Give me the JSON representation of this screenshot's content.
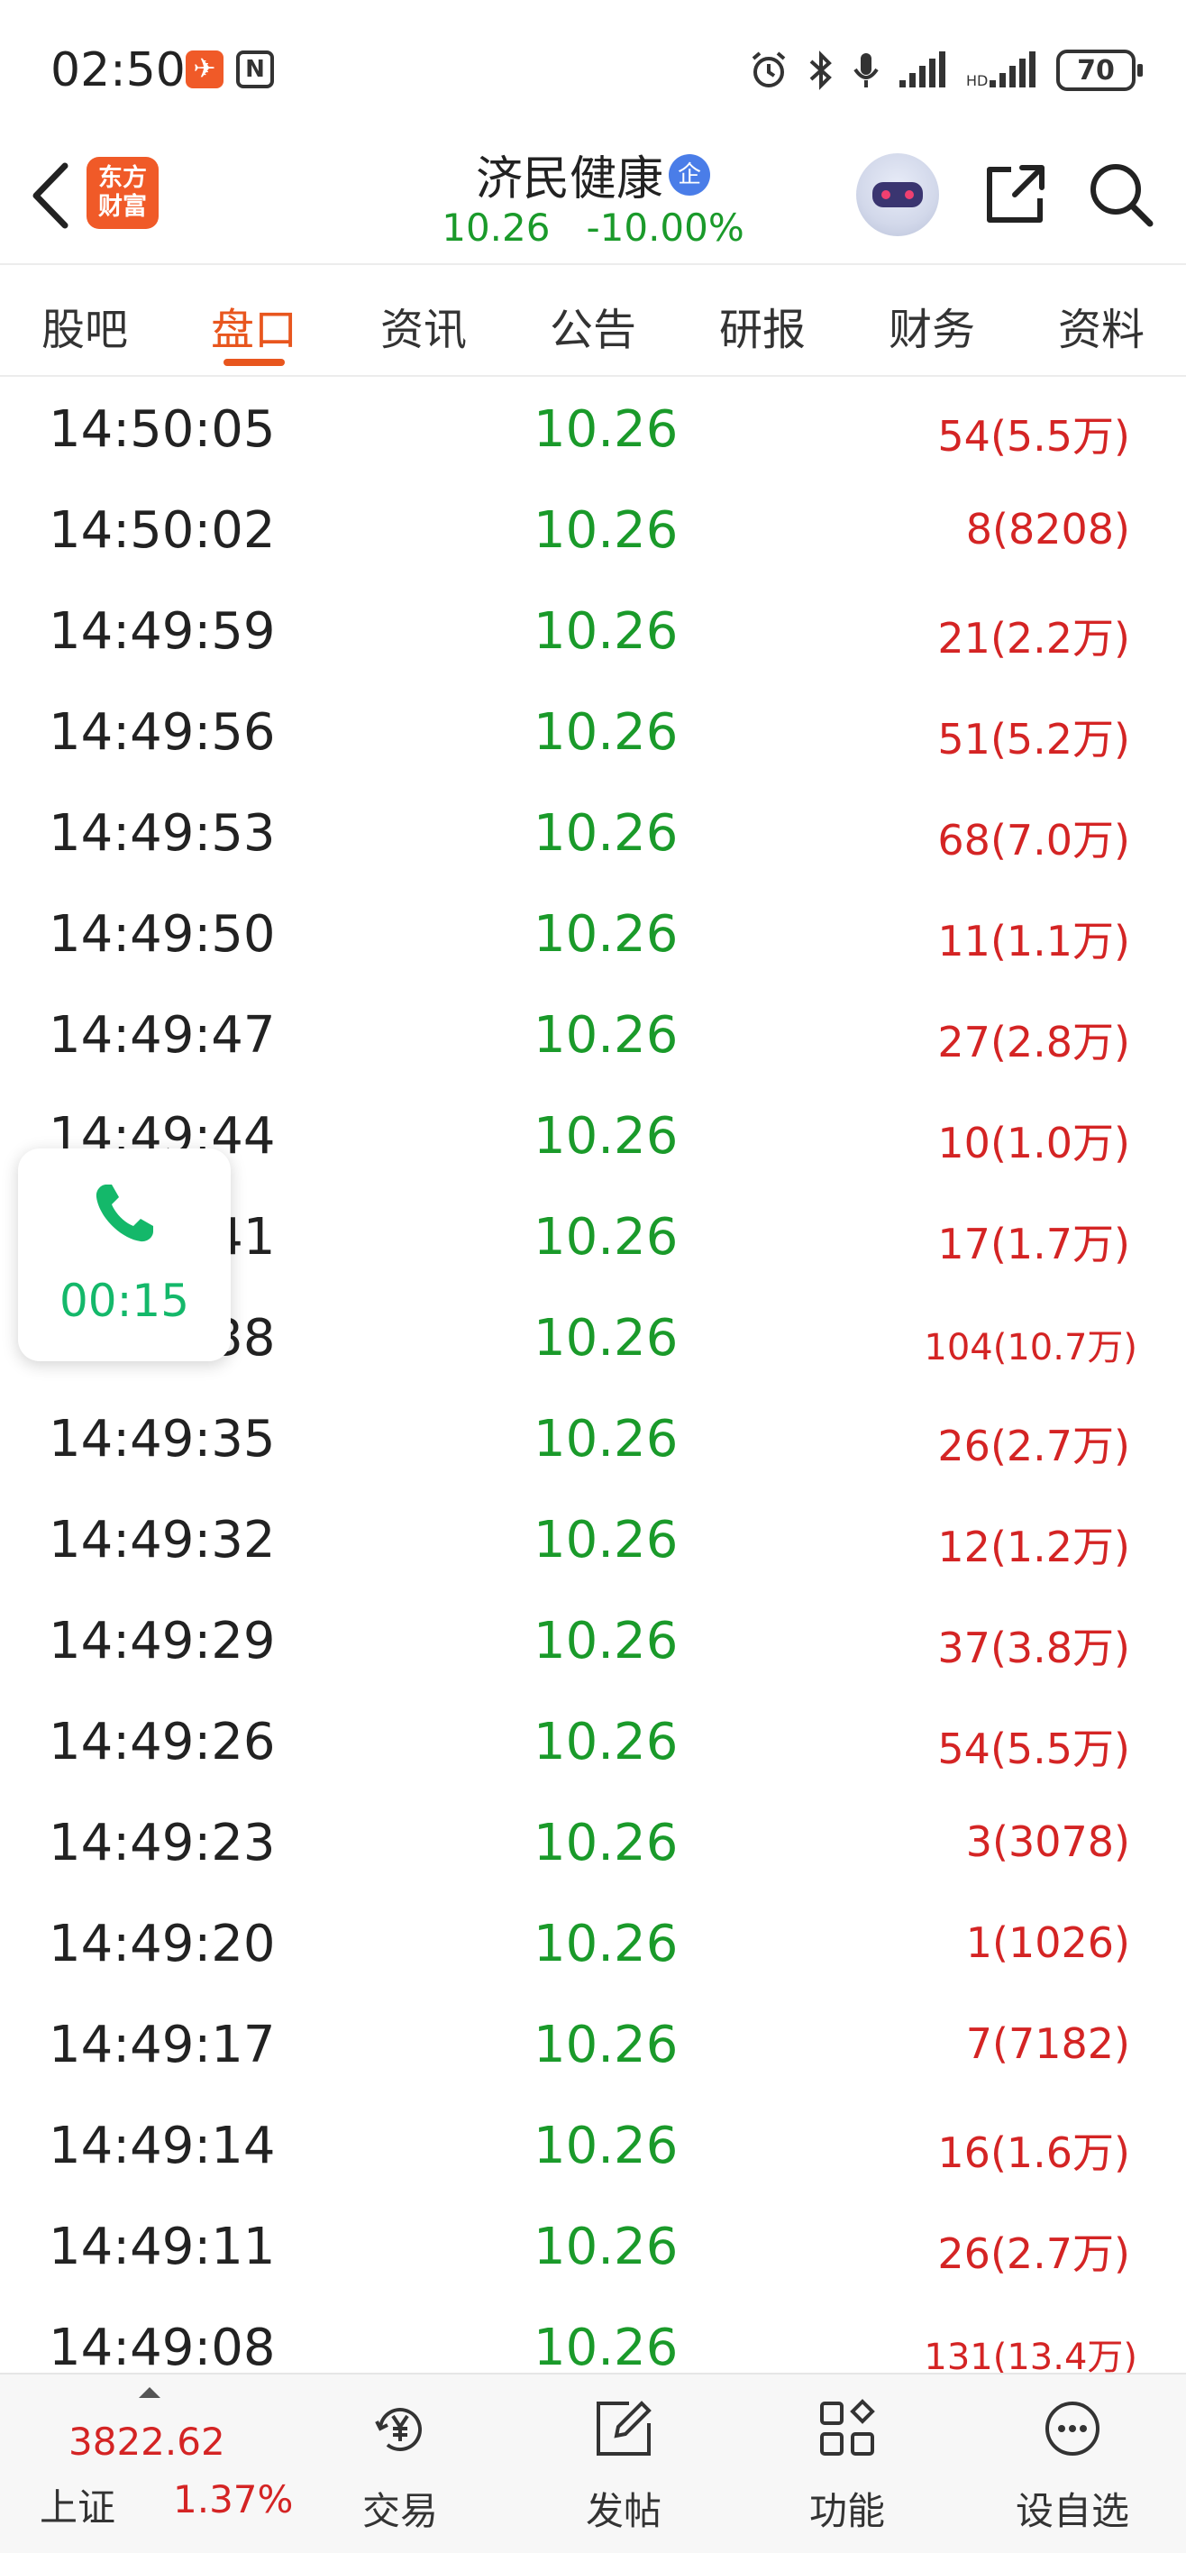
{
  "status_bar": {
    "time": "02:50",
    "battery": "70"
  },
  "header": {
    "brand_logo": "东方\n财富",
    "stock_name": "济民健康",
    "verified_badge": "企",
    "price": "10.26",
    "change_pct": "-10.00%"
  },
  "tabs": [
    {
      "label": "股吧"
    },
    {
      "label": "盘口",
      "active": true
    },
    {
      "label": "资讯"
    },
    {
      "label": "公告"
    },
    {
      "label": "研报"
    },
    {
      "label": "财务"
    },
    {
      "label": "资料"
    }
  ],
  "trades": [
    {
      "time": "14:50:05",
      "price": "10.26",
      "volume": "54(5.5万)"
    },
    {
      "time": "14:50:02",
      "price": "10.26",
      "volume": "8(8208)"
    },
    {
      "time": "14:49:59",
      "price": "10.26",
      "volume": "21(2.2万)"
    },
    {
      "time": "14:49:56",
      "price": "10.26",
      "volume": "51(5.2万)"
    },
    {
      "time": "14:49:53",
      "price": "10.26",
      "volume": "68(7.0万)"
    },
    {
      "time": "14:49:50",
      "price": "10.26",
      "volume": "11(1.1万)"
    },
    {
      "time": "14:49:47",
      "price": "10.26",
      "volume": "27(2.8万)"
    },
    {
      "time": "14:49:44",
      "price": "10.26",
      "volume": "10(1.0万)"
    },
    {
      "time": "14:49:41",
      "price": "10.26",
      "volume": "17(1.7万)"
    },
    {
      "time": "14:49:38",
      "price": "10.26",
      "volume": "104(10.7万)"
    },
    {
      "time": "14:49:35",
      "price": "10.26",
      "volume": "26(2.7万)"
    },
    {
      "time": "14:49:32",
      "price": "10.26",
      "volume": "12(1.2万)"
    },
    {
      "time": "14:49:29",
      "price": "10.26",
      "volume": "37(3.8万)"
    },
    {
      "time": "14:49:26",
      "price": "10.26",
      "volume": "54(5.5万)"
    },
    {
      "time": "14:49:23",
      "price": "10.26",
      "volume": "3(3078)"
    },
    {
      "time": "14:49:20",
      "price": "10.26",
      "volume": "1(1026)"
    },
    {
      "time": "14:49:17",
      "price": "10.26",
      "volume": "7(7182)"
    },
    {
      "time": "14:49:14",
      "price": "10.26",
      "volume": "16(1.6万)"
    },
    {
      "time": "14:49:11",
      "price": "10.26",
      "volume": "26(2.7万)"
    },
    {
      "time": "14:49:08",
      "price": "10.26",
      "volume": "131(13.4万)"
    }
  ],
  "call_widget": {
    "timer": "00:15"
  },
  "bottom_bar": {
    "index_value": "3822.62",
    "index_name": "上证",
    "index_change": "1.37%",
    "nav": [
      {
        "label": "交易",
        "icon": "yen-refresh-icon"
      },
      {
        "label": "发帖",
        "icon": "edit-post-icon"
      },
      {
        "label": "功能",
        "icon": "grid-apps-icon"
      },
      {
        "label": "设自选",
        "icon": "more-dots-icon"
      }
    ]
  },
  "colors": {
    "accent": "#e8561e",
    "price_down": "#1a9a2a",
    "price_up": "#d42424",
    "call_green": "#14b86a"
  }
}
